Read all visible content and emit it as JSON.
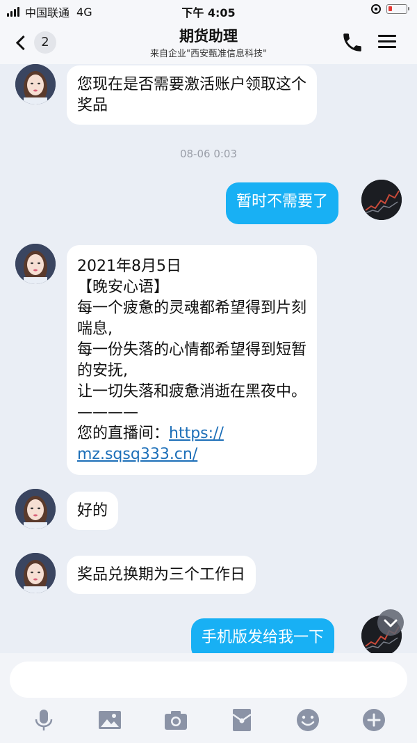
{
  "status_bar": {
    "carrier": "中国联通",
    "network": "4G",
    "time": "下午 4:05"
  },
  "nav": {
    "unread_count": "2",
    "title": "期货助理",
    "subtitle": "来自企业\"西安甄准信息科技\""
  },
  "messages": [
    {
      "side": "in",
      "lines": [
        "您现在是否需要激活账户领取这个",
        "奖品"
      ]
    },
    {
      "type": "time",
      "text": "08-06 0:03"
    },
    {
      "side": "out",
      "lines": [
        "暂时不需要了"
      ]
    },
    {
      "side": "in",
      "lines": [
        "2021年8月5日",
        "【晚安心语】",
        "每一个疲惫的灵魂都希望得到片刻",
        "喘息,",
        "每一份失落的心情都希望得到短暂",
        "的安抚,",
        "让一切失落和疲惫消逝在黑夜中。",
        "————",
        "您的直播间：",
        "mz.sqsq333.cn/"
      ],
      "link_prefix": "https://"
    },
    {
      "side": "in",
      "lines": [
        "好的"
      ]
    },
    {
      "side": "in",
      "lines": [
        "奖品兑换期为三个工作日"
      ]
    },
    {
      "side": "out",
      "lines": [
        "手机版发给我一下"
      ]
    }
  ],
  "input": {
    "placeholder": ""
  },
  "toolbar": [
    "microphone-icon",
    "image-icon",
    "camera-icon",
    "red-packet-icon",
    "emoji-icon",
    "plus-icon"
  ],
  "colors": {
    "outgoing_bubble": "#18b0f4",
    "incoming_bubble": "#ffffff",
    "background": "#eaeef5",
    "link": "#1d6fb8"
  }
}
